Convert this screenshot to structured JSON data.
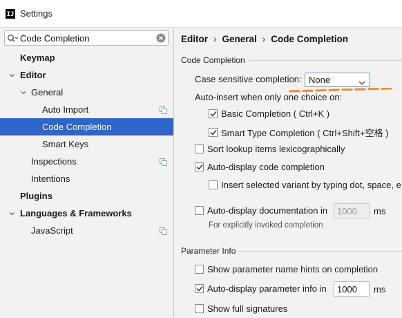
{
  "window": {
    "title": "Settings",
    "logo_text": "IJ"
  },
  "search": {
    "value": "Code Completion"
  },
  "sidebar": {
    "items": [
      {
        "label": "Keymap"
      },
      {
        "label": "Editor"
      },
      {
        "label": "General"
      },
      {
        "label": "Auto Import"
      },
      {
        "label": "Code Completion"
      },
      {
        "label": "Smart Keys"
      },
      {
        "label": "Inspections"
      },
      {
        "label": "Intentions"
      },
      {
        "label": "Plugins"
      },
      {
        "label": "Languages & Frameworks"
      },
      {
        "label": "JavaScript"
      }
    ]
  },
  "breadcrumb": {
    "parts": [
      "Editor",
      "General",
      "Code Completion"
    ],
    "separator": "›"
  },
  "code_completion": {
    "section_title": "Code Completion",
    "case_sensitive_label": "Case sensitive completion:",
    "case_sensitive_value": "None",
    "auto_insert_label": "Auto-insert when only one choice on:",
    "basic_completion": "Basic Completion ( Ctrl+K )",
    "smart_type_completion": "Smart Type Completion ( Ctrl+Shift+空格 )",
    "sort_lookup": "Sort lookup items lexicographically",
    "auto_display_completion": "Auto-display code completion",
    "insert_selected_variant": "Insert selected variant by typing dot, space, e",
    "auto_display_documentation": "Auto-display documentation in",
    "documentation_delay": "1000",
    "documentation_unit": "ms",
    "documentation_hint": "For explicitly invoked completion"
  },
  "parameter_info": {
    "section_title": "Parameter Info",
    "show_hints": "Show parameter name hints on completion",
    "auto_display_param": "Auto-display parameter info in",
    "param_delay": "1000",
    "param_unit": "ms",
    "show_full_signatures": "Show full signatures"
  },
  "checkbox_states": {
    "basic_completion": true,
    "smart_type_completion": true,
    "sort_lookup": false,
    "auto_display_completion": true,
    "insert_selected_variant": false,
    "auto_display_documentation": false,
    "show_hints": false,
    "auto_display_param": true,
    "show_full_signatures": false
  },
  "colors": {
    "selection": "#2f65ca",
    "annotation": "#f08a24",
    "focus_border": "#6f97c9"
  }
}
